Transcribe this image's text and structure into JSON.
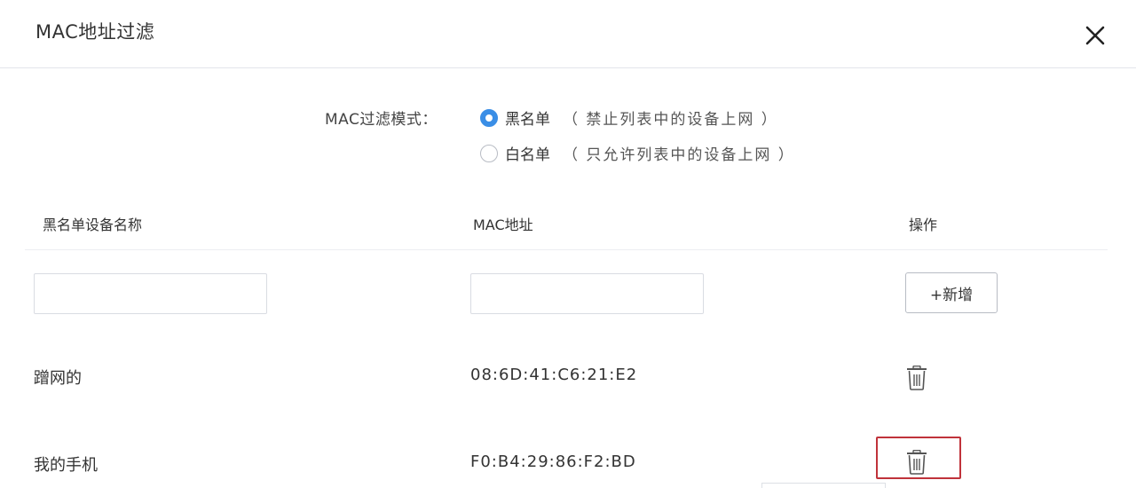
{
  "dialog": {
    "title": "MAC地址过滤",
    "close_icon": "close-icon"
  },
  "filter_mode": {
    "label": "MAC过滤模式：",
    "options": [
      {
        "label": "黑名单",
        "description": "（ 禁止列表中的设备上网 ）",
        "checked": true
      },
      {
        "label": "白名单",
        "description": "（ 只允许列表中的设备上网 ）",
        "checked": false
      }
    ]
  },
  "table": {
    "headers": {
      "name": "黑名单设备名称",
      "mac": "MAC地址",
      "action": "操作"
    },
    "new_row": {
      "name_value": "",
      "mac_value": "",
      "add_label": "+新增"
    },
    "rows": [
      {
        "name": "蹭网的",
        "mac": "08:6D:41:C6:21:E2",
        "action_icon": "trash-icon"
      },
      {
        "name": "我的手机",
        "mac": "F0:B4:29:86:F2:BD",
        "action_icon": "trash-icon"
      }
    ]
  },
  "colors": {
    "accent": "#3a8ee6",
    "highlight": "#c0333b"
  }
}
